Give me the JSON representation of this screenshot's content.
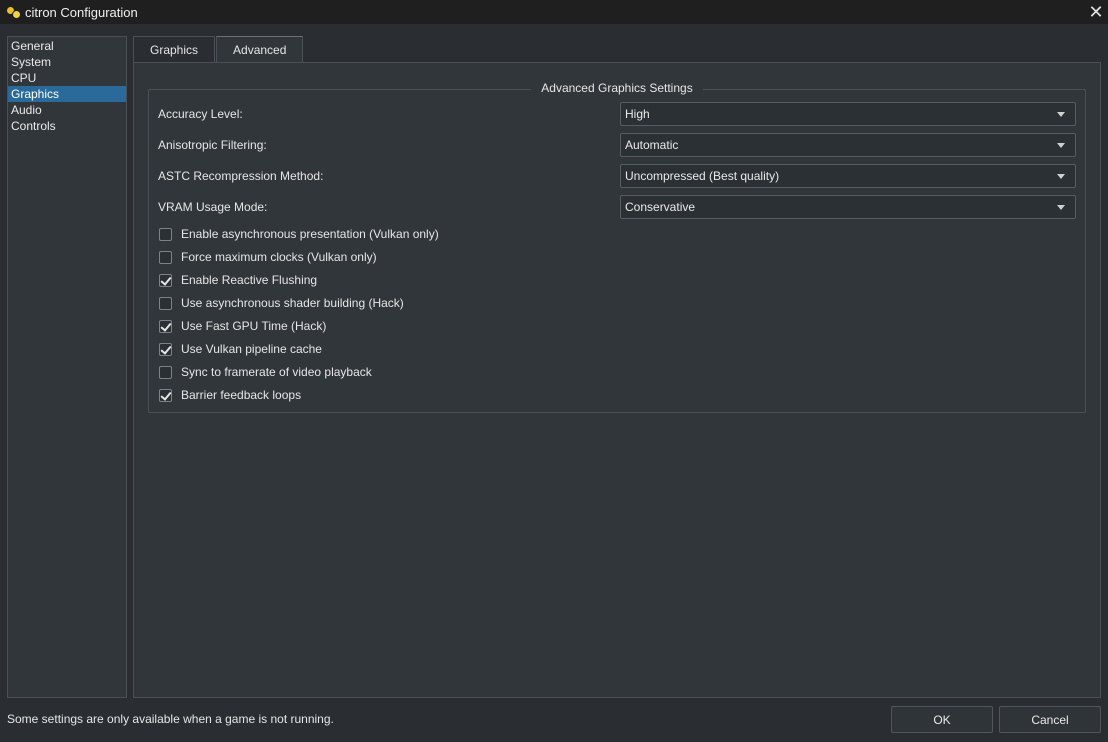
{
  "window": {
    "title": "citron Configuration"
  },
  "sidebar": {
    "items": [
      {
        "label": "General"
      },
      {
        "label": "System"
      },
      {
        "label": "CPU"
      },
      {
        "label": "Graphics",
        "selected": true
      },
      {
        "label": "Audio"
      },
      {
        "label": "Controls"
      }
    ]
  },
  "tabs": [
    {
      "label": "Graphics"
    },
    {
      "label": "Advanced",
      "active": true
    }
  ],
  "group": {
    "title": "Advanced Graphics Settings",
    "settings": [
      {
        "label": "Accuracy Level:",
        "value": "High"
      },
      {
        "label": "Anisotropic Filtering:",
        "value": "Automatic"
      },
      {
        "label": "ASTC Recompression Method:",
        "value": "Uncompressed (Best quality)"
      },
      {
        "label": "VRAM Usage Mode:",
        "value": "Conservative"
      }
    ],
    "checkboxes": [
      {
        "label": "Enable asynchronous presentation (Vulkan only)",
        "checked": false
      },
      {
        "label": "Force maximum clocks (Vulkan only)",
        "checked": false
      },
      {
        "label": "Enable Reactive Flushing",
        "checked": true
      },
      {
        "label": "Use asynchronous shader building (Hack)",
        "checked": false
      },
      {
        "label": "Use Fast GPU Time (Hack)",
        "checked": true
      },
      {
        "label": "Use Vulkan pipeline cache",
        "checked": true
      },
      {
        "label": "Sync to framerate of video playback",
        "checked": false
      },
      {
        "label": "Barrier feedback loops",
        "checked": true
      }
    ]
  },
  "footer": {
    "note": "Some settings are only available when a game is not running.",
    "ok_label": "OK",
    "cancel_label": "Cancel"
  },
  "colors": {
    "background": "#2a2e33",
    "panel": "#31363b",
    "selection": "#2a6a9a"
  }
}
